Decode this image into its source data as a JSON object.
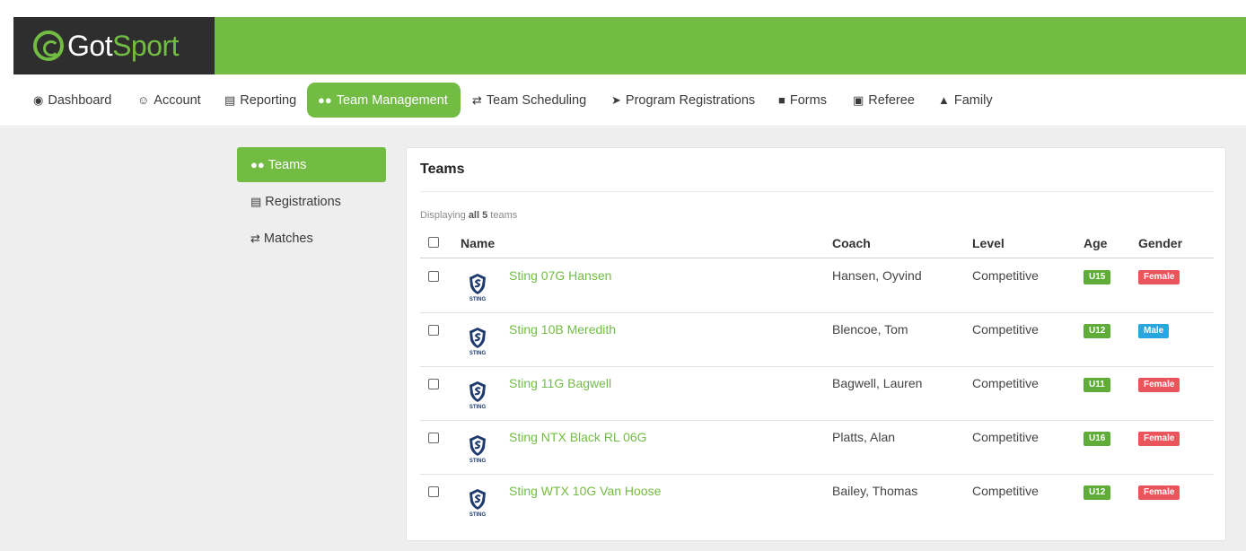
{
  "brand": {
    "got": "Got",
    "sport": "Sport"
  },
  "colors": {
    "brand_green": "#72bc44",
    "logo_bg": "#2e2e2e",
    "female_badge": "#e9555a",
    "male_badge": "#2aa6df"
  },
  "nav": {
    "items": [
      {
        "label": "Dashboard",
        "icon": "dashboard-icon"
      },
      {
        "label": "Account",
        "icon": "user-circle-icon"
      },
      {
        "label": "Reporting",
        "icon": "report-icon"
      },
      {
        "label": "Team Management",
        "icon": "users-icon",
        "active": true
      },
      {
        "label": "Team Scheduling",
        "icon": "exchange-icon"
      },
      {
        "label": "Program Registrations",
        "icon": "paper-plane-icon"
      },
      {
        "label": "Forms",
        "icon": "file-icon"
      },
      {
        "label": "Referee",
        "icon": "calendar-icon"
      },
      {
        "label": "Family",
        "icon": "sitemap-icon"
      }
    ]
  },
  "sidebar": {
    "items": [
      {
        "label": "Teams",
        "icon": "users-icon",
        "active": true
      },
      {
        "label": "Registrations",
        "icon": "list-icon"
      },
      {
        "label": "Matches",
        "icon": "exchange-icon"
      }
    ]
  },
  "panel": {
    "title": "Teams",
    "displaying_prefix": "Displaying",
    "displaying_all": "all 5",
    "displaying_suffix": "teams",
    "columns": {
      "name": "Name",
      "coach": "Coach",
      "level": "Level",
      "age": "Age",
      "gender": "Gender"
    },
    "rows": [
      {
        "name": "Sting 07G Hansen",
        "coach": "Hansen, Oyvind",
        "level": "Competitive",
        "age": "U15",
        "gender": "Female"
      },
      {
        "name": "Sting 10B Meredith",
        "coach": "Blencoe, Tom",
        "level": "Competitive",
        "age": "U12",
        "gender": "Male"
      },
      {
        "name": "Sting 11G Bagwell",
        "coach": "Bagwell, Lauren",
        "level": "Competitive",
        "age": "U11",
        "gender": "Female"
      },
      {
        "name": "Sting NTX Black RL 06G",
        "coach": "Platts, Alan",
        "level": "Competitive",
        "age": "U16",
        "gender": "Female"
      },
      {
        "name": "Sting WTX 10G Van Hoose",
        "coach": "Bailey, Thomas",
        "level": "Competitive",
        "age": "U12",
        "gender": "Female"
      }
    ],
    "crest_text": "STING"
  }
}
